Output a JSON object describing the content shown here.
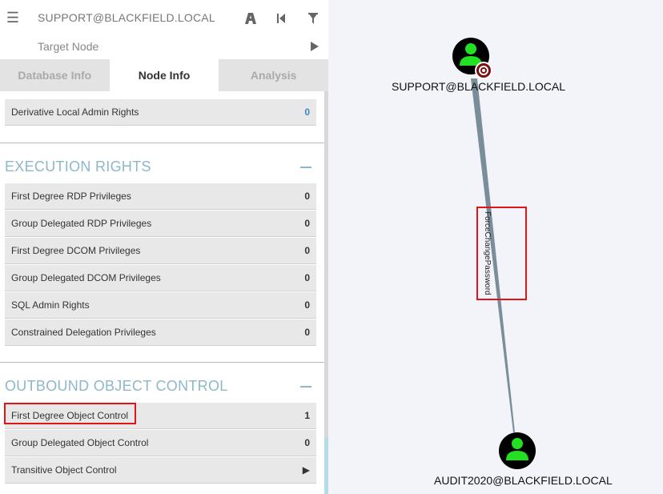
{
  "search": {
    "source_value": "SUPPORT@BLACKFIELD.LOCAL",
    "target_placeholder": "Target Node"
  },
  "tabs": [
    {
      "label": "Database Info"
    },
    {
      "label": "Node Info"
    },
    {
      "label": "Analysis"
    }
  ],
  "top_partial_row": {
    "label": "Derivative Local Admin Rights",
    "value": "0"
  },
  "execution_rights": {
    "title": "EXECUTION RIGHTS",
    "rows": [
      {
        "label": "First Degree RDP Privileges",
        "value": "0"
      },
      {
        "label": "Group Delegated RDP Privileges",
        "value": "0"
      },
      {
        "label": "First Degree DCOM Privileges",
        "value": "0"
      },
      {
        "label": "Group Delegated DCOM Privileges",
        "value": "0"
      },
      {
        "label": "SQL Admin Rights",
        "value": "0"
      },
      {
        "label": "Constrained Delegation Privileges",
        "value": "0"
      }
    ]
  },
  "outbound_object_control": {
    "title": "OUTBOUND OBJECT CONTROL",
    "rows": [
      {
        "label": "First Degree Object Control",
        "value": "1"
      },
      {
        "label": "Group Delegated Object Control",
        "value": "0"
      },
      {
        "label": "Transitive Object Control",
        "value": "▶"
      }
    ]
  },
  "graph": {
    "source_node": "SUPPORT@BLACKFIELD.LOCAL",
    "target_node": "AUDIT2020@BLACKFIELD.LOCAL",
    "edge_label": "ForceChangePassword"
  },
  "colors": {
    "accent": "#8cb8c8",
    "highlight": "#e0151a",
    "node_icon": "#22e022",
    "edge": "#7a8e9a"
  },
  "icons": [
    "hamburger-menu-icon",
    "pathfinding-icon",
    "back-icon",
    "filter-icon",
    "play-icon",
    "user-icon",
    "target-icon"
  ]
}
